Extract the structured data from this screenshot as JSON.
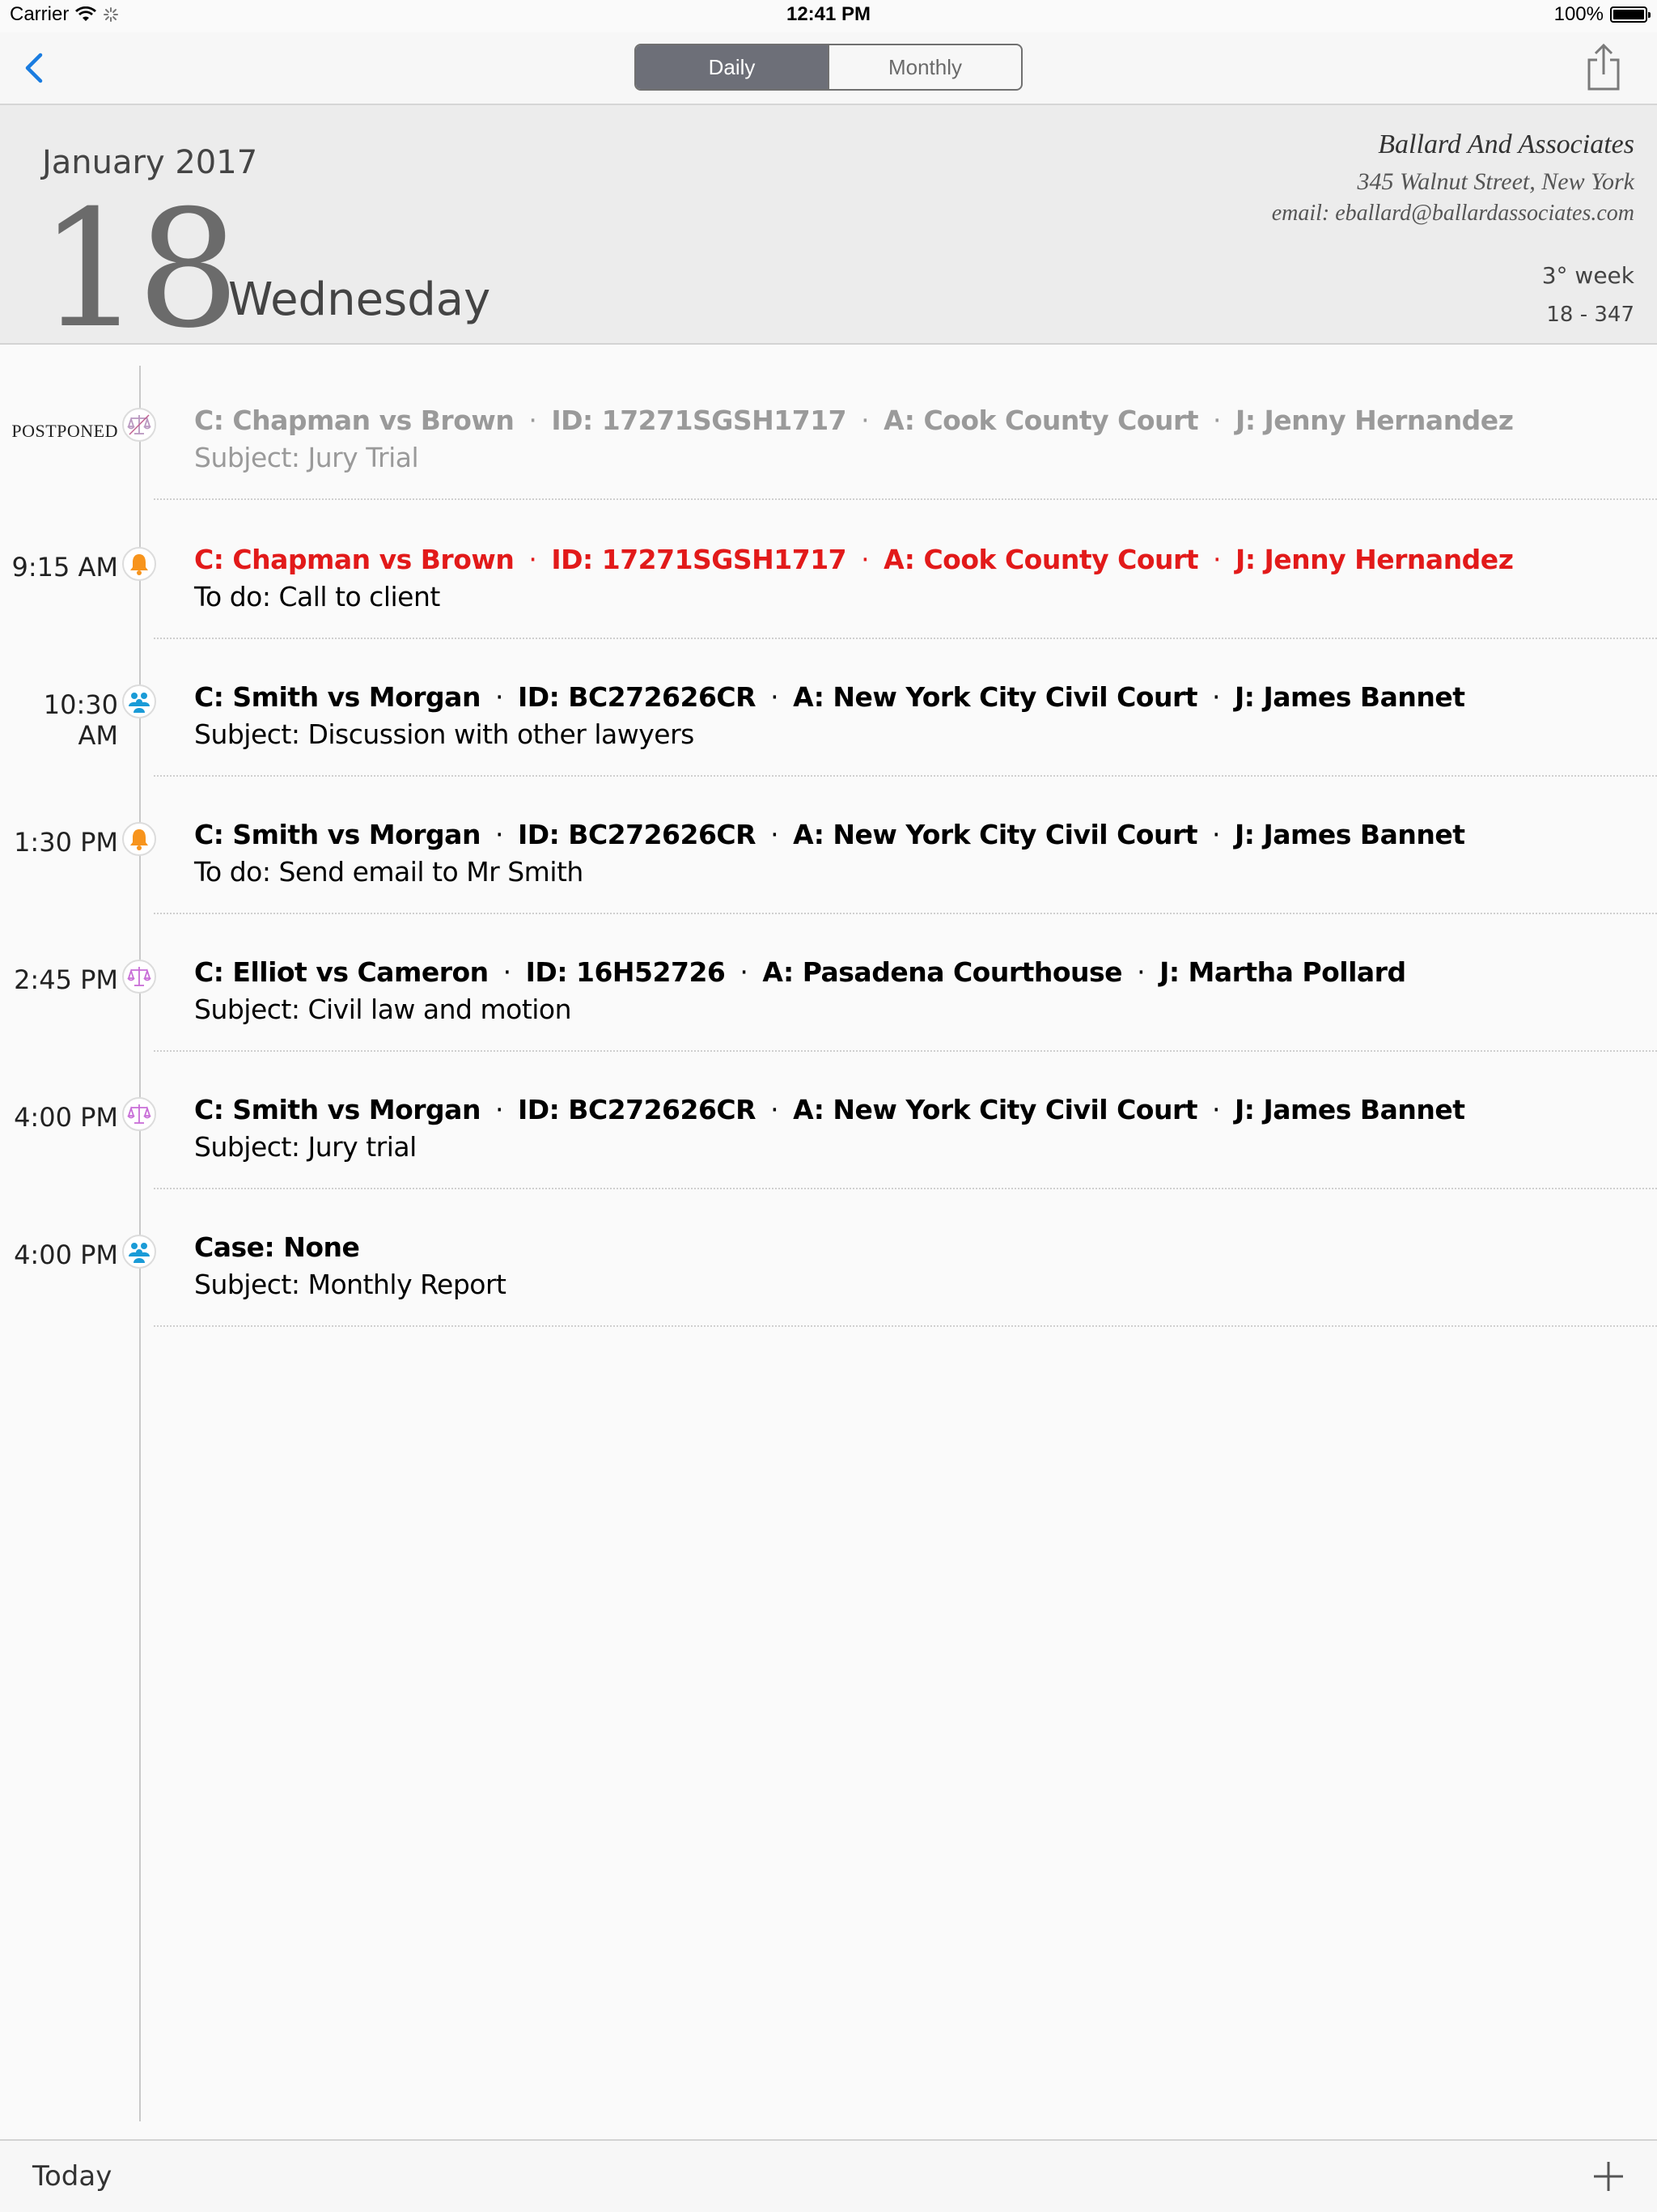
{
  "status_bar": {
    "carrier": "Carrier",
    "time": "12:41 PM",
    "battery": "100%"
  },
  "nav": {
    "segments": [
      "Daily",
      "Monthly"
    ],
    "active_segment": "Daily",
    "icons": [
      "back-chevron-icon",
      "share-icon"
    ]
  },
  "header": {
    "month_year": "January 2017",
    "day": "18",
    "weekday": "Wednesday",
    "firm_name": "Ballard And Associates",
    "firm_address": "345 Walnut Street, New York",
    "firm_email": "email: eballard@ballardassociates.com",
    "week": "3° week",
    "day_count": "18 - 347"
  },
  "events": [
    {
      "time": "POSTPONED",
      "icon": "scales-icon",
      "status": "postponed",
      "case": "C: Chapman vs Brown",
      "id": "ID: 17271SGSH1717",
      "court": "A: Cook County Court",
      "judge": "J: Jenny Hernandez",
      "subject": "Subject: Jury Trial"
    },
    {
      "time": "9:15 AM",
      "icon": "bell-icon",
      "status": "urgent",
      "case": "C: Chapman vs Brown",
      "id": "ID: 17271SGSH1717",
      "court": "A: Cook County Court",
      "judge": "J: Jenny Hernandez",
      "subject": "To do: Call to client"
    },
    {
      "time": "10:30 AM",
      "icon": "meeting-icon",
      "status": "normal",
      "case": "C: Smith vs Morgan",
      "id": "ID: BC272626CR",
      "court": "A: New York City Civil Court",
      "judge": "J: James Bannet",
      "subject": "Subject: Discussion with other lawyers"
    },
    {
      "time": "1:30 PM",
      "icon": "bell-icon",
      "status": "normal",
      "case": "C: Smith vs Morgan",
      "id": "ID: BC272626CR",
      "court": "A: New York City Civil Court",
      "judge": "J: James Bannet",
      "subject": "To do: Send email to Mr Smith"
    },
    {
      "time": "2:45 PM",
      "icon": "scales-icon",
      "status": "normal",
      "case": "C: Elliot vs Cameron",
      "id": "ID: 16H52726",
      "court": "A: Pasadena Courthouse",
      "judge": "J: Martha Pollard",
      "subject": "Subject: Civil law and motion"
    },
    {
      "time": "4:00 PM",
      "icon": "scales-icon",
      "status": "normal",
      "case": "C: Smith vs Morgan",
      "id": "ID: BC272626CR",
      "court": "A: New York City Civil Court",
      "judge": "J: James Bannet",
      "subject": "Subject: Jury trial"
    },
    {
      "time": "4:00 PM",
      "icon": "meeting-icon",
      "status": "normal",
      "case": "Case: None",
      "id": null,
      "court": null,
      "judge": null,
      "subject": "Subject: Monthly Report"
    }
  ],
  "toolbar": {
    "today_label": "Today",
    "icons": [
      "add-icon"
    ]
  },
  "colors": {
    "urgent": "#e21a1a",
    "postponed": "#9a9a9a",
    "bell": "#f7941d",
    "meeting": "#1a9bd7",
    "scales": "#c86dd7",
    "tint": "#1a7ce0"
  }
}
